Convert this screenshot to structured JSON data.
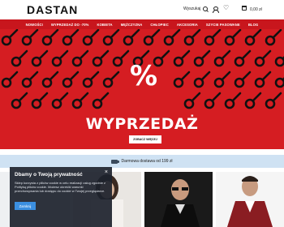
{
  "header": {
    "logo": "DASTAN",
    "search_label": "Wyszukaj",
    "cart_total": "0,00 zł"
  },
  "nav": {
    "items": [
      "Nowości",
      "Wyprzedaż do -70%",
      "Kobieta",
      "Mężczyzna",
      "Chłopiec",
      "Akcesoria",
      "Szycie pasowane",
      "Blog"
    ]
  },
  "hero": {
    "percent": "%",
    "headline": "WYPRZEDAŻ",
    "cta_label": "Zobacz więcej",
    "background_color": "#d51d22"
  },
  "shipping": {
    "text": "Darmowa dostawa od 199 zł"
  },
  "cookie": {
    "title": "Dbamy o Twoją prywatność",
    "text": "Sklep korzysta z plików cookie w celu realizacji usług zgodnie z Polityką plików cookie. Możesz określić warunki przechowywania lub dostępu do cookie w Twojej przeglądarce.",
    "accept_label": "Zamknij",
    "close_icon": "close-icon"
  }
}
